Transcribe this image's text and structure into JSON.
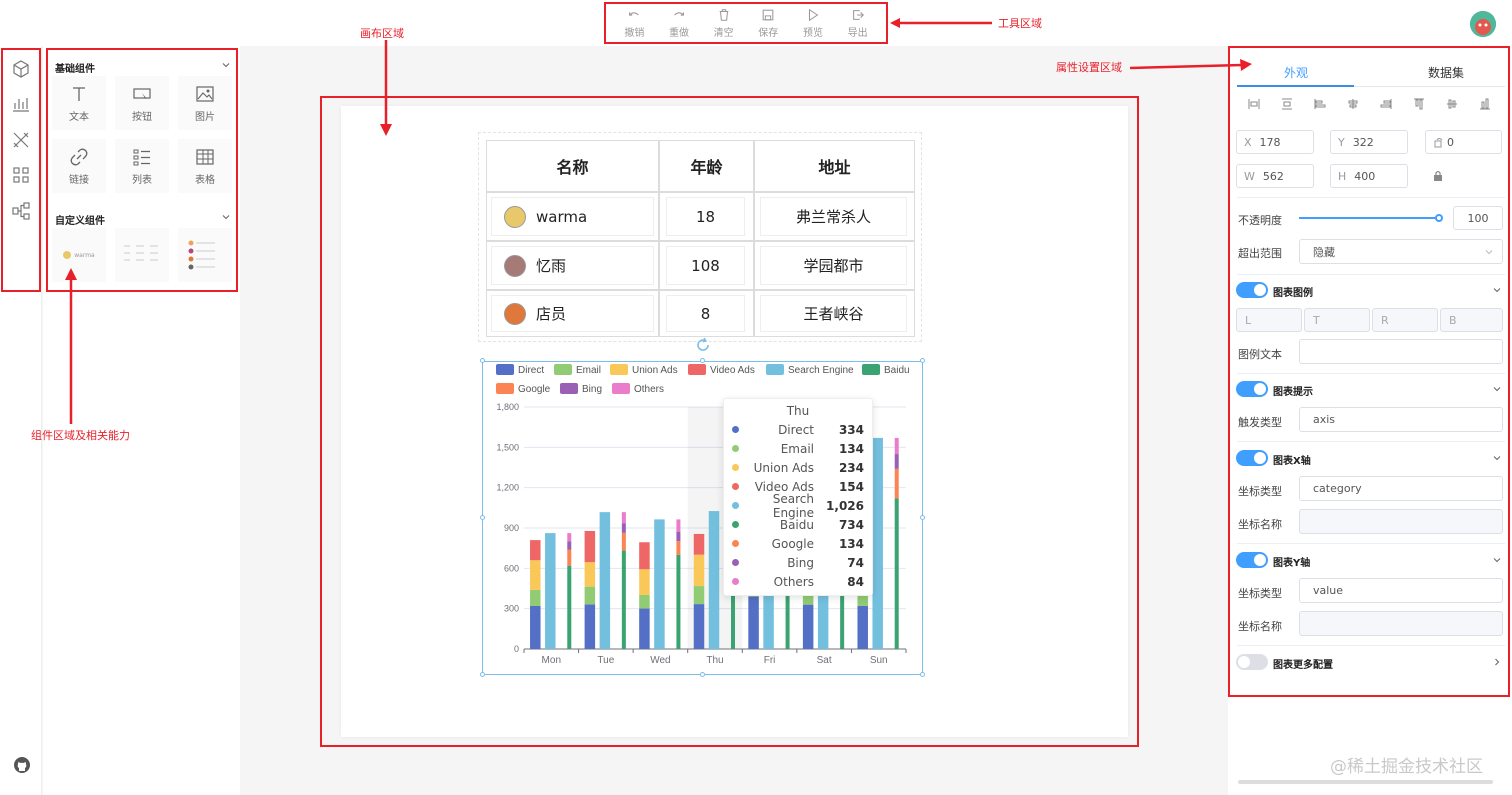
{
  "toolbar": {
    "undo": "撤销",
    "redo": "重做",
    "clear": "清空",
    "save": "保存",
    "preview": "预览",
    "export": "导出"
  },
  "components": {
    "basic_title": "基础组件",
    "basic": [
      {
        "label": "文本",
        "icon": "text-icon"
      },
      {
        "label": "按钮",
        "icon": "button-icon"
      },
      {
        "label": "图片",
        "icon": "image-icon"
      },
      {
        "label": "链接",
        "icon": "link-icon"
      },
      {
        "label": "列表",
        "icon": "list-icon"
      },
      {
        "label": "表格",
        "icon": "table-icon"
      }
    ],
    "custom_title": "自定义组件",
    "custom_preview_text": "warma"
  },
  "table": {
    "headers": [
      "名称",
      "年龄",
      "地址"
    ],
    "rows": [
      {
        "name": "warma",
        "age": "18",
        "address": "弗兰常杀人"
      },
      {
        "name": "忆雨",
        "age": "108",
        "address": "学园都市"
      },
      {
        "name": "店员",
        "age": "8",
        "address": "王者峡谷"
      }
    ]
  },
  "chart_data": {
    "type": "bar",
    "stacked": true,
    "categories": [
      "Mon",
      "Tue",
      "Wed",
      "Thu",
      "Fri",
      "Sat",
      "Sun"
    ],
    "ylim": [
      0,
      1800
    ],
    "yticks": [
      "0",
      "300",
      "600",
      "900",
      "1,200",
      "1,500",
      "1,800"
    ],
    "legend_position": "top",
    "series": [
      {
        "name": "Direct",
        "color": "#5470c6",
        "stack": "A",
        "values": [
          320,
          332,
          301,
          334,
          390,
          330,
          320
        ]
      },
      {
        "name": "Email",
        "color": "#91cc75",
        "stack": "A",
        "values": [
          120,
          132,
          101,
          134,
          90,
          230,
          210
        ]
      },
      {
        "name": "Union Ads",
        "color": "#fac858",
        "stack": "A",
        "values": [
          220,
          182,
          191,
          234,
          290,
          330,
          310
        ]
      },
      {
        "name": "Video Ads",
        "color": "#ee6666",
        "stack": "A",
        "values": [
          150,
          232,
          201,
          154,
          190,
          330,
          410
        ]
      },
      {
        "name": "Search Engine",
        "color": "#73c0de",
        "stack": "B",
        "values": [
          862,
          1018,
          964,
          1026,
          1679,
          1600,
          1570
        ]
      },
      {
        "name": "Baidu",
        "color": "#3ba272",
        "stack": "C",
        "values": [
          620,
          732,
          701,
          734,
          1090,
          1130,
          1120
        ]
      },
      {
        "name": "Google",
        "color": "#fc8452",
        "stack": "C",
        "values": [
          120,
          132,
          101,
          134,
          290,
          230,
          220
        ]
      },
      {
        "name": "Bing",
        "color": "#9a60b4",
        "stack": "C",
        "values": [
          60,
          72,
          71,
          74,
          190,
          130,
          110
        ]
      },
      {
        "name": "Others",
        "color": "#ea7ccc",
        "stack": "C",
        "values": [
          62,
          82,
          91,
          84,
          109,
          110,
          120
        ]
      }
    ],
    "tooltip": {
      "title": "Thu",
      "items": [
        {
          "name": "Direct",
          "value": "334",
          "color": "#5470c6"
        },
        {
          "name": "Email",
          "value": "134",
          "color": "#91cc75"
        },
        {
          "name": "Union Ads",
          "value": "234",
          "color": "#fac858"
        },
        {
          "name": "Video Ads",
          "value": "154",
          "color": "#ee6666"
        },
        {
          "name": "Search Engine",
          "value": "1,026",
          "color": "#73c0de"
        },
        {
          "name": "Baidu",
          "value": "734",
          "color": "#3ba272"
        },
        {
          "name": "Google",
          "value": "134",
          "color": "#fc8452"
        },
        {
          "name": "Bing",
          "value": "74",
          "color": "#9a60b4"
        },
        {
          "name": "Others",
          "value": "84",
          "color": "#ea7ccc"
        }
      ]
    }
  },
  "props": {
    "tab_appearance": "外观",
    "tab_dataset": "数据集",
    "x_label": "X",
    "x_value": "178",
    "y_label": "Y",
    "y_value": "322",
    "rotate_value": "0",
    "w_label": "W",
    "w_value": "562",
    "h_label": "H",
    "h_value": "400",
    "opacity_label": "不透明度",
    "opacity_value": "100",
    "opacity_fraction": 1.0,
    "overflow_label": "超出范围",
    "overflow_value": "隐藏",
    "legend_title": "图表图例",
    "legend_l": "L",
    "legend_t": "T",
    "legend_r": "R",
    "legend_b": "B",
    "legend_text_label": "图例文本",
    "tooltip_title": "图表提示",
    "trigger_label": "触发类型",
    "trigger_value": "axis",
    "xaxis_title": "图表X轴",
    "xaxis_type_label": "坐标类型",
    "xaxis_type_value": "category",
    "xaxis_name_label": "坐标名称",
    "yaxis_title": "图表Y轴",
    "yaxis_type_label": "坐标类型",
    "yaxis_type_value": "value",
    "yaxis_name_label": "坐标名称",
    "more_title": "图表更多配置"
  },
  "annotations": {
    "toolbar_area": "工具区域",
    "canvas_area": "画布区域",
    "property_area": "属性设置区域",
    "component_area": "组件区域及相关能力"
  },
  "watermark": "@稀土掘金技术社区",
  "colors": {
    "accent": "#409eff",
    "annotation": "#e8202a"
  }
}
